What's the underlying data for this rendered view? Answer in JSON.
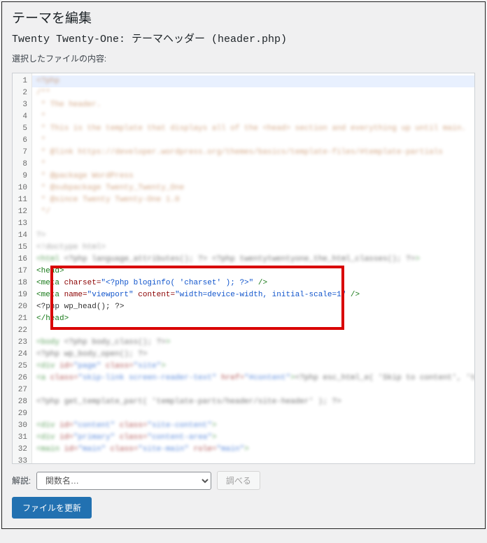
{
  "page": {
    "title": "テーマを編集",
    "file_title": "Twenty Twenty-One: テーマヘッダー (header.php)",
    "content_label": "選択したファイルの内容:"
  },
  "code": {
    "line17": {
      "tag": "<head>",
      "cls": "c-tag"
    },
    "line18_pre": "  <meta ",
    "line18_attr": "charset=",
    "line18_val": "\"<?php bloginfo( 'charset' ); ?>\"",
    "line18_end": " />",
    "line19_pre": "  <meta ",
    "line19_attr_name": "name=",
    "line19_val_name": "\"viewport\"",
    "line19_attr_content": " content=",
    "line19_val_content": "\"width=device-width, initial-scale=1\"",
    "line19_end": " />",
    "line20": "  <?php wp_head(); ?>",
    "line21": "</head>"
  },
  "lookup": {
    "label": "解説:",
    "placeholder": "関数名…",
    "button": "調べる"
  },
  "submit": {
    "label": "ファイルを更新"
  }
}
